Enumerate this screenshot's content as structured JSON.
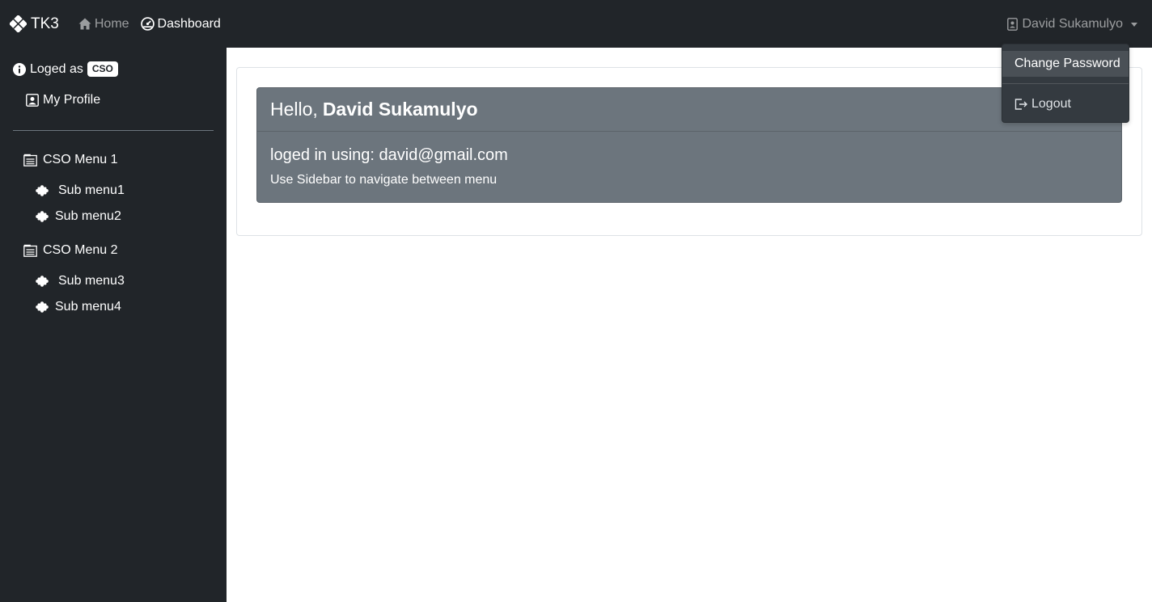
{
  "navbar": {
    "brand": "TK3",
    "links": [
      {
        "label": "Home",
        "active": false
      },
      {
        "label": "Dashboard",
        "active": true
      }
    ],
    "user_name": "David Sukamulyo"
  },
  "dropdown": {
    "items": [
      "Change Password",
      "Logout"
    ]
  },
  "sidebar": {
    "logged_prefix": "Loged as",
    "role": "CSO",
    "profile_label": "My Profile",
    "menus": [
      {
        "label": "CSO Menu 1",
        "subs": [
          "Sub menu1",
          "Sub menu2"
        ]
      },
      {
        "label": "CSO Menu 2",
        "subs": [
          "Sub menu3",
          "Sub menu4"
        ]
      }
    ]
  },
  "main": {
    "greeting": "Hello,",
    "user_name": "David Sukamulyo",
    "login_line": "loged in using: david@gmail.com",
    "note": "Use Sidebar to navigate between menu"
  },
  "colors": {
    "navbar_bg": "#212529",
    "card_bg": "#6c757d",
    "dropdown_bg": "#343a40"
  }
}
